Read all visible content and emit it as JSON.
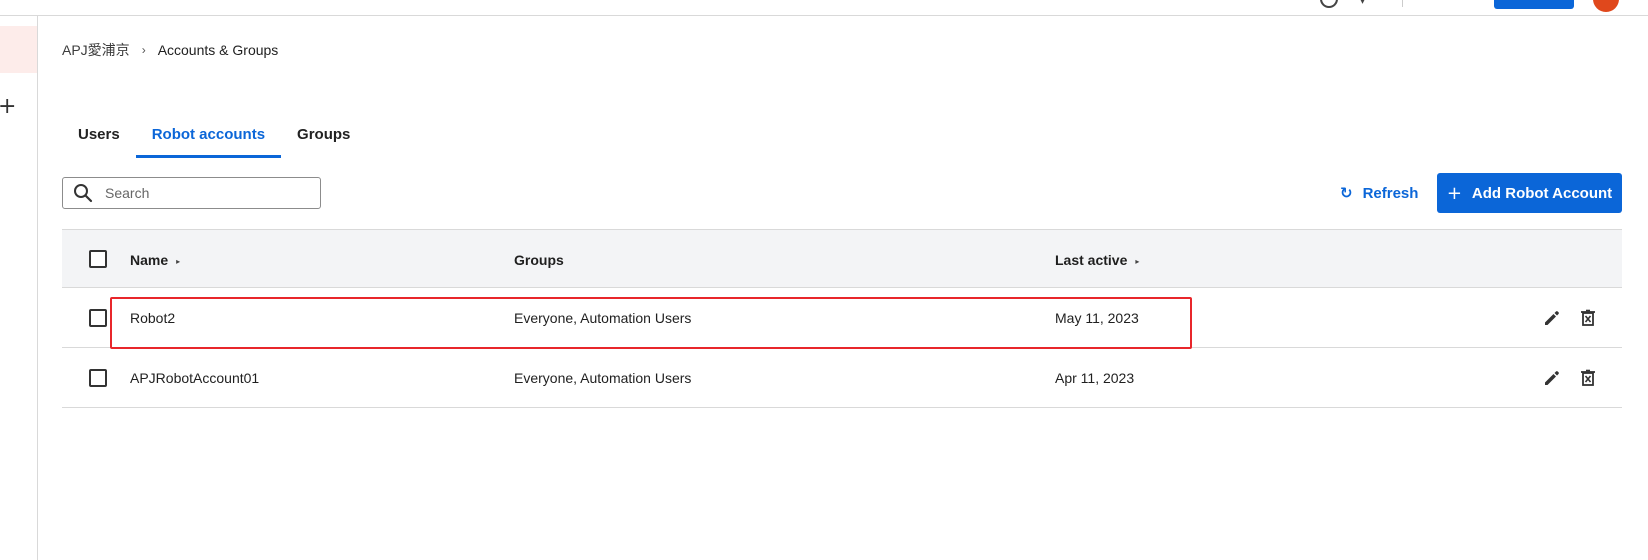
{
  "breadcrumb": {
    "root": "APJ愛浦京",
    "separator": "›",
    "current": "Accounts & Groups"
  },
  "tabs": [
    {
      "label": "Users",
      "active": false
    },
    {
      "label": "Robot accounts",
      "active": true
    },
    {
      "label": "Groups",
      "active": false
    }
  ],
  "search": {
    "placeholder": "Search",
    "value": ""
  },
  "toolbar": {
    "refresh_label": "Refresh",
    "refresh_icon": "↻",
    "add_label": "Add Robot Account",
    "add_icon": "+"
  },
  "table": {
    "headers": {
      "name": "Name",
      "groups": "Groups",
      "last_active": "Last active",
      "sort_icon": "▸"
    },
    "rows": [
      {
        "name": "Robot2",
        "groups": "Everyone, Automation Users",
        "last_active": "May 11, 2023",
        "highlighted": true
      },
      {
        "name": "APJRobotAccount01",
        "groups": "Everyone, Automation Users",
        "last_active": "Apr 11, 2023",
        "highlighted": false
      }
    ]
  },
  "left_rail": {
    "add_icon": "+"
  },
  "colors": {
    "accent": "#0b66d8",
    "highlight": "#e8262b",
    "avatar": "#e0481c",
    "header_bg": "#f3f4f6"
  },
  "icons": [
    "search-icon",
    "refresh-icon",
    "plus-icon",
    "sort-icon",
    "edit-icon",
    "delete-icon",
    "help-icon",
    "add-icon"
  ]
}
